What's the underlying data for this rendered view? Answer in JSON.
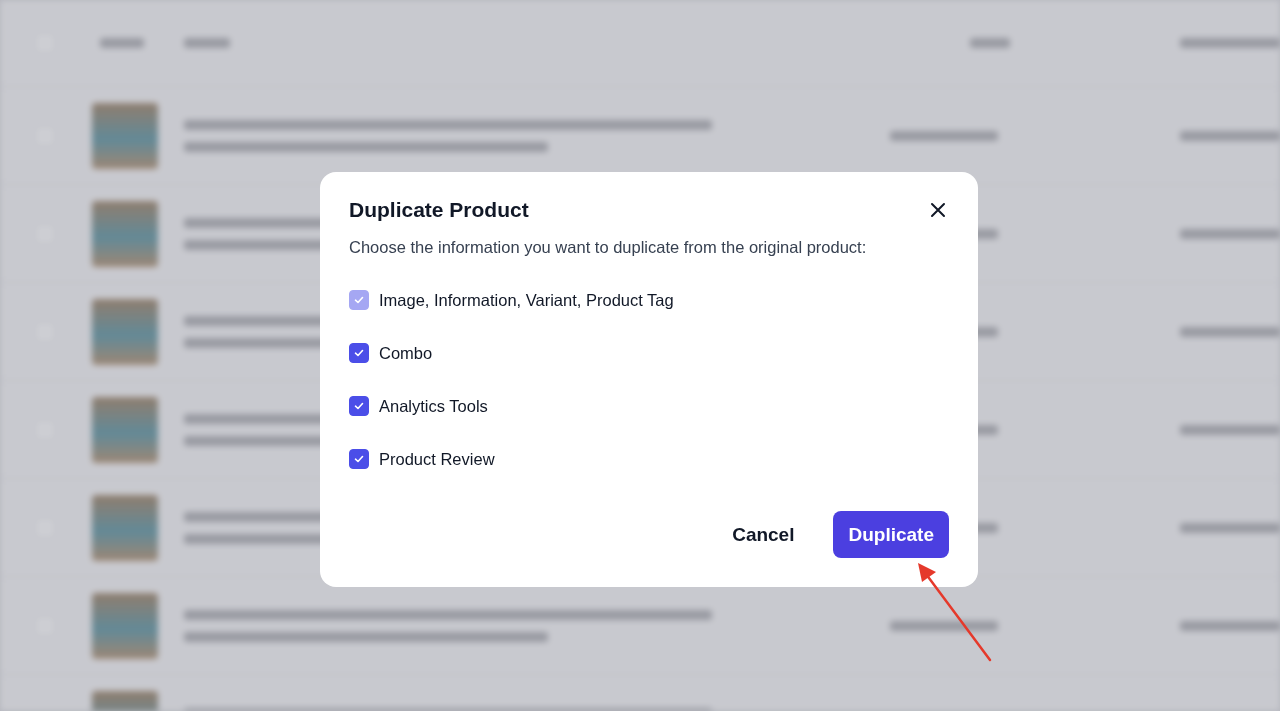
{
  "dialog": {
    "title": "Duplicate Product",
    "description": "Choose the information you want to duplicate from the original product:",
    "options": [
      {
        "label": "Image, Information, Variant, Product Tag",
        "checked": true,
        "disabled": true
      },
      {
        "label": "Combo",
        "checked": true,
        "disabled": false
      },
      {
        "label": "Analytics Tools",
        "checked": true,
        "disabled": false
      },
      {
        "label": "Product Review",
        "checked": true,
        "disabled": false
      }
    ],
    "buttons": [
      {
        "label": "Cancel",
        "kind": "secondary"
      },
      {
        "label": "Duplicate",
        "kind": "primary"
      }
    ]
  }
}
